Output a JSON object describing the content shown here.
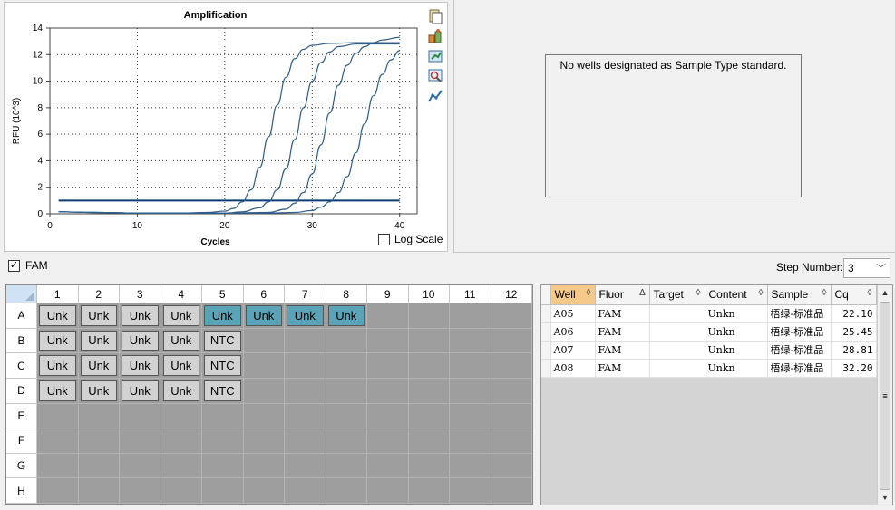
{
  "chart_data": {
    "type": "line",
    "title": "Amplification",
    "xlabel": "Cycles",
    "ylabel": "RFU (10^3)",
    "xlim": [
      0,
      42
    ],
    "ylim": [
      0,
      14
    ],
    "xticks": [
      0,
      10,
      20,
      30,
      40
    ],
    "yticks": [
      0,
      2,
      4,
      6,
      8,
      10,
      12,
      14
    ],
    "grid": true,
    "threshold": 1.0,
    "series": [
      {
        "x": [
          1,
          5,
          10,
          15,
          18,
          20,
          21,
          22,
          23,
          24,
          25,
          26,
          27,
          28,
          29,
          30,
          32,
          35,
          40
        ],
        "values": [
          0.15,
          0.1,
          0.05,
          0.05,
          0.1,
          0.2,
          0.4,
          0.9,
          1.8,
          3.5,
          5.8,
          8.2,
          10.3,
          11.7,
          12.4,
          12.7,
          12.85,
          12.9,
          12.9
        ]
      },
      {
        "x": [
          1,
          5,
          10,
          15,
          20,
          22,
          24,
          25,
          26,
          27,
          28,
          29,
          30,
          31,
          32,
          33,
          35,
          38,
          40
        ],
        "values": [
          0.15,
          0.1,
          0.05,
          0.05,
          0.05,
          0.15,
          0.45,
          0.9,
          1.8,
          3.4,
          5.6,
          8.0,
          10.0,
          11.4,
          12.2,
          12.6,
          12.8,
          12.8,
          12.8
        ]
      },
      {
        "x": [
          1,
          5,
          10,
          15,
          20,
          25,
          27,
          28,
          29,
          30,
          31,
          32,
          33,
          34,
          35,
          36,
          37,
          38,
          40
        ],
        "values": [
          0.15,
          0.1,
          0.05,
          0.05,
          0.05,
          0.1,
          0.35,
          0.8,
          1.6,
          3.0,
          5.2,
          7.6,
          9.7,
          11.2,
          12.1,
          12.6,
          12.9,
          13.1,
          13.3
        ]
      },
      {
        "x": [
          1,
          5,
          10,
          15,
          20,
          25,
          28,
          30,
          31,
          32,
          33,
          34,
          35,
          36,
          37,
          38,
          39,
          40
        ],
        "values": [
          0.15,
          0.1,
          0.05,
          0.05,
          0.05,
          0.05,
          0.1,
          0.25,
          0.5,
          0.9,
          1.6,
          2.8,
          4.6,
          6.8,
          8.9,
          10.5,
          11.6,
          12.3
        ]
      }
    ]
  },
  "toolbar_icons": [
    "copy-icon",
    "export-icon",
    "refresh-icon",
    "zoom-icon",
    "chart-options-icon"
  ],
  "log_scale_label": "Log Scale",
  "log_scale_checked": false,
  "std_message": "No wells designated as Sample Type standard.",
  "fluor_label": "FAM",
  "fluor_checked": true,
  "step_label": "Step Number:",
  "step_value": "3",
  "plate": {
    "columns": [
      "1",
      "2",
      "3",
      "4",
      "5",
      "6",
      "7",
      "8",
      "9",
      "10",
      "11",
      "12"
    ],
    "rows": [
      "A",
      "B",
      "C",
      "D",
      "E",
      "F",
      "G",
      "H"
    ],
    "wells": {
      "A": [
        "Unk",
        "Unk",
        "Unk",
        "Unk",
        "Unk",
        "Unk",
        "Unk",
        "Unk",
        "",
        "",
        "",
        ""
      ],
      "B": [
        "Unk",
        "Unk",
        "Unk",
        "Unk",
        "NTC",
        "",
        "",
        "",
        "",
        "",
        "",
        ""
      ],
      "C": [
        "Unk",
        "Unk",
        "Unk",
        "Unk",
        "NTC",
        "",
        "",
        "",
        "",
        "",
        "",
        ""
      ],
      "D": [
        "Unk",
        "Unk",
        "Unk",
        "Unk",
        "NTC",
        "",
        "",
        "",
        "",
        "",
        "",
        ""
      ],
      "E": [
        "",
        "",
        "",
        "",
        "",
        "",
        "",
        "",
        "",
        "",
        "",
        ""
      ],
      "F": [
        "",
        "",
        "",
        "",
        "",
        "",
        "",
        "",
        "",
        "",
        "",
        ""
      ],
      "G": [
        "",
        "",
        "",
        "",
        "",
        "",
        "",
        "",
        "",
        "",
        "",
        ""
      ],
      "H": [
        "",
        "",
        "",
        "",
        "",
        "",
        "",
        "",
        "",
        "",
        "",
        ""
      ]
    },
    "selected_wells": [
      "A5",
      "A6",
      "A7",
      "A8"
    ]
  },
  "results_table": {
    "headers": [
      "Well",
      "Fluor",
      "Target",
      "Content",
      "Sample",
      "Cq"
    ],
    "sort_markers": [
      "◊",
      "∆",
      "◊",
      "◊",
      "◊",
      "◊"
    ],
    "rows": [
      {
        "well": "A05",
        "fluor": "FAM",
        "target": "",
        "content": "Unkn",
        "sample": "梧绿-标准品",
        "cq": "22.10"
      },
      {
        "well": "A06",
        "fluor": "FAM",
        "target": "",
        "content": "Unkn",
        "sample": "梧绿-标准品",
        "cq": "25.45"
      },
      {
        "well": "A07",
        "fluor": "FAM",
        "target": "",
        "content": "Unkn",
        "sample": "梧绿-标准品",
        "cq": "28.81"
      },
      {
        "well": "A08",
        "fluor": "FAM",
        "target": "",
        "content": "Unkn",
        "sample": "梧绿-标准品",
        "cq": "32.20"
      }
    ]
  },
  "colors": {
    "curve": "#2f5d8a",
    "threshold": "#0b3d73",
    "selected_well": "#5ba3b6",
    "sorted_header": "#f5c98a"
  }
}
